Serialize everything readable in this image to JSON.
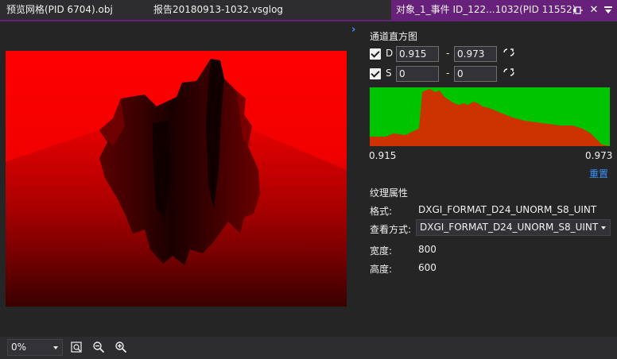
{
  "tabs": [
    {
      "label": "预览网格(PID 6704).obj",
      "active": false
    },
    {
      "label": "报告20180913-1032.vsglog",
      "active": false
    },
    {
      "label": "对象_1_事件 ID_122...1032(PID 11552)",
      "active": true
    }
  ],
  "icons": {
    "pin": "pin-icon",
    "close": "✕",
    "tab_menu": "dropdown-menu-icon",
    "collapse": "›",
    "reset_range": "refresh-icon",
    "fit": "fit-to-window-icon",
    "zoom_out": "zoom-out-icon",
    "zoom_in": "zoom-in-icon"
  },
  "histogram_section": {
    "title": "通道直方图",
    "channels": [
      {
        "label": "D",
        "checked": true,
        "from": "0.915",
        "dash": "-",
        "to": "0.973"
      },
      {
        "label": "S",
        "checked": true,
        "from": "0",
        "dash": "-",
        "to": "0"
      }
    ],
    "min_label": "0.915",
    "max_label": "0.973",
    "reset_label": "重置",
    "colors": {
      "background": "#00c400",
      "fill": "#cc3300"
    }
  },
  "texture_properties": {
    "title": "纹理属性",
    "format_label": "格式:",
    "format_value": "DXGI_FORMAT_D24_UNORM_S8_UINT",
    "view_label": "查看方式:",
    "view_value": "DXGI_FORMAT_D24_UNORM_S8_UINT",
    "width_label": "宽度:",
    "width_value": "800",
    "height_label": "高度:",
    "height_value": "600"
  },
  "toolbar": {
    "zoom_value": "0%"
  },
  "colors": {
    "accent": "#68217a",
    "link": "#3794ff",
    "background": "#252526",
    "preview_red": "#ff0000"
  }
}
